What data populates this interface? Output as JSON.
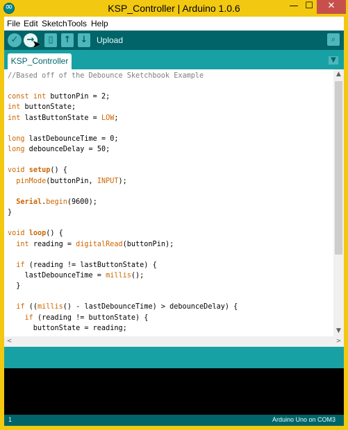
{
  "window": {
    "title": "KSP_Controller | Arduino 1.0.6",
    "minimize_glyph": "—",
    "maximize_glyph": "☐",
    "close_glyph": "✕"
  },
  "menu": {
    "items": [
      "File",
      "Edit",
      "Sketch",
      "Tools",
      "Help"
    ]
  },
  "toolbar": {
    "hover_label": "Upload",
    "buttons": [
      {
        "name": "verify",
        "icon": "check-icon",
        "glyph": "✓"
      },
      {
        "name": "upload",
        "icon": "arrow-right-icon",
        "glyph": "→"
      },
      {
        "name": "new",
        "icon": "new-file-icon",
        "glyph": "▯"
      },
      {
        "name": "open",
        "icon": "arrow-up-icon",
        "glyph": "↑"
      },
      {
        "name": "save",
        "icon": "arrow-down-icon",
        "glyph": "↓"
      }
    ],
    "serial_monitor_glyph": "⌕"
  },
  "tabs": {
    "items": [
      {
        "label": "KSP_Controller"
      }
    ],
    "menu_glyph": "▼"
  },
  "editor": {
    "lines": [
      [
        {
          "t": "//Based off of the Debounce Sketchbook Example",
          "c": "cm"
        }
      ],
      [],
      [
        {
          "t": "const",
          "c": "kw"
        },
        {
          "t": " "
        },
        {
          "t": "int",
          "c": "kw"
        },
        {
          "t": " buttonPin = 2;"
        }
      ],
      [
        {
          "t": "int",
          "c": "kw"
        },
        {
          "t": " buttonState;"
        }
      ],
      [
        {
          "t": "int",
          "c": "kw"
        },
        {
          "t": " lastButtonState = "
        },
        {
          "t": "LOW",
          "c": "kw"
        },
        {
          "t": ";"
        }
      ],
      [],
      [
        {
          "t": "long",
          "c": "kw"
        },
        {
          "t": " lastDebounceTime = 0;"
        }
      ],
      [
        {
          "t": "long",
          "c": "kw"
        },
        {
          "t": " debounceDelay = 50;"
        }
      ],
      [],
      [
        {
          "t": "void",
          "c": "kw"
        },
        {
          "t": " "
        },
        {
          "t": "setup",
          "c": "kw2"
        },
        {
          "t": "() {"
        }
      ],
      [
        {
          "t": "  "
        },
        {
          "t": "pinMode",
          "c": "kw"
        },
        {
          "t": "(buttonPin, "
        },
        {
          "t": "INPUT",
          "c": "kw"
        },
        {
          "t": ");"
        }
      ],
      [],
      [
        {
          "t": "  "
        },
        {
          "t": "Serial",
          "c": "kw2"
        },
        {
          "t": "."
        },
        {
          "t": "begin",
          "c": "kw"
        },
        {
          "t": "(9600);"
        }
      ],
      [
        {
          "t": "}"
        }
      ],
      [],
      [
        {
          "t": "void",
          "c": "kw"
        },
        {
          "t": " "
        },
        {
          "t": "loop",
          "c": "kw2"
        },
        {
          "t": "() {"
        }
      ],
      [
        {
          "t": "  "
        },
        {
          "t": "int",
          "c": "kw"
        },
        {
          "t": " reading = "
        },
        {
          "t": "digitalRead",
          "c": "kw"
        },
        {
          "t": "(buttonPin);"
        }
      ],
      [],
      [
        {
          "t": "  "
        },
        {
          "t": "if",
          "c": "kw"
        },
        {
          "t": " (reading != lastButtonState) {"
        }
      ],
      [
        {
          "t": "    lastDebounceTime = "
        },
        {
          "t": "millis",
          "c": "kw"
        },
        {
          "t": "();"
        }
      ],
      [
        {
          "t": "  }"
        }
      ],
      [],
      [
        {
          "t": "  "
        },
        {
          "t": "if",
          "c": "kw"
        },
        {
          "t": " (("
        },
        {
          "t": "millis",
          "c": "kw"
        },
        {
          "t": "() - lastDebounceTime) > debounceDelay) {"
        }
      ],
      [
        {
          "t": "    "
        },
        {
          "t": "if",
          "c": "kw"
        },
        {
          "t": " (reading != buttonState) {"
        }
      ],
      [
        {
          "t": "      buttonState = reading;"
        }
      ]
    ]
  },
  "scrollbars": {
    "up_glyph": "▲",
    "down_glyph": "▼",
    "left_glyph": "<",
    "right_glyph": ">"
  },
  "status": {
    "line_number": "1",
    "board": "Arduino Uno on COM3"
  },
  "colors": {
    "frame": "#f2c811",
    "toolbar": "#006468",
    "tabbar": "#17a1a5",
    "keyword": "#cc6600",
    "comment": "#7e7e7e",
    "close_button": "#c7504c"
  }
}
